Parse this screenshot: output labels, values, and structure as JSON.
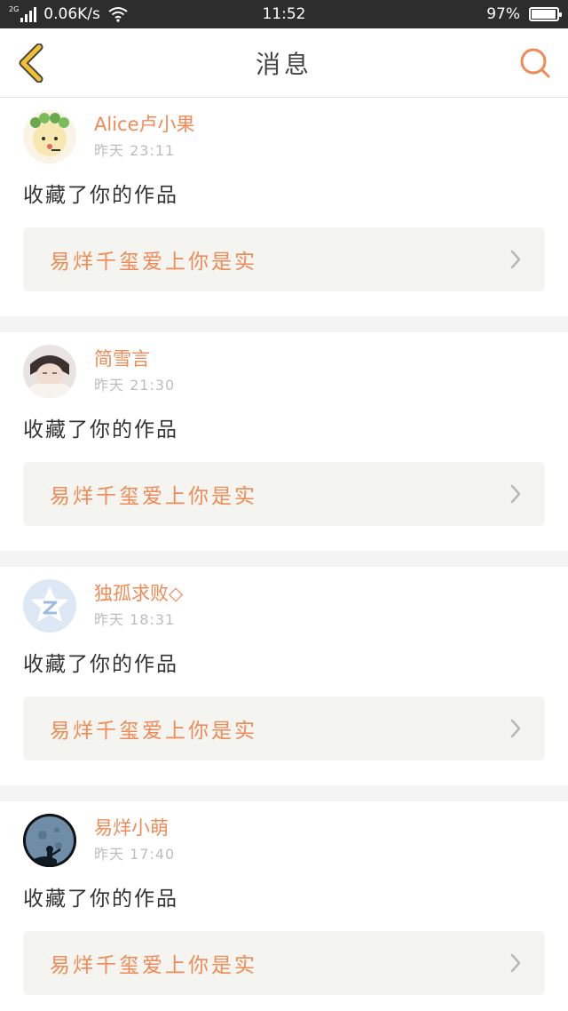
{
  "status_bar": {
    "network_tag": "2G",
    "speed": "0.06K/s",
    "time": "11:52",
    "battery_percent": "97%",
    "battery_level": 0.97
  },
  "nav": {
    "title": "消息",
    "back_icon": "chevron-left-icon",
    "search_icon": "search-icon"
  },
  "colors": {
    "accent": "#f08a56",
    "back_icon": "#f2c12e",
    "card_box": "#f4f4f0"
  },
  "messages": [
    {
      "username": "Alice卢小果",
      "time": "昨天 23:11",
      "action": "收藏了你的作品",
      "work_title": "易烊千玺爱上你是实"
    },
    {
      "username": "简雪言",
      "time": "昨天 21:30",
      "action": "收藏了你的作品",
      "work_title": "易烊千玺爱上你是实"
    },
    {
      "username": "独孤求败◇",
      "time": "昨天 18:31",
      "action": "收藏了你的作品",
      "work_title": "易烊千玺爱上你是实"
    },
    {
      "username": "易烊小萌",
      "time": "昨天 17:40",
      "action": "收藏了你的作品",
      "work_title": "易烊千玺爱上你是实"
    }
  ]
}
